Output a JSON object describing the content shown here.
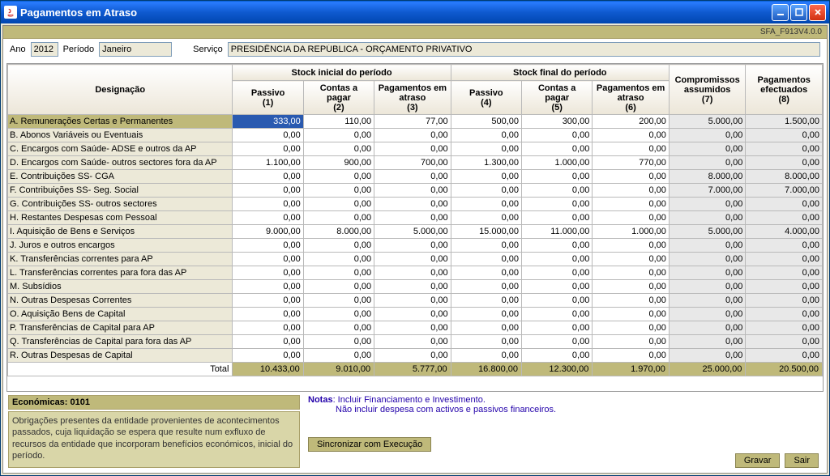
{
  "window": {
    "title": "Pagamentos em Atraso"
  },
  "version": "SFA_F913V4.0.0",
  "filters": {
    "ano_label": "Ano",
    "ano": "2012",
    "periodo_label": "Período",
    "periodo": "Janeiro",
    "servico_label": "Serviço",
    "servico": "PRESIDÊNCIA DA REPÚBLICA - ORÇAMENTO PRIVATIVO"
  },
  "headers": {
    "designacao": "Designação",
    "stock_inicial": "Stock inicial do período",
    "stock_final": "Stock final do período",
    "compromissos": "Compromissos assumidos",
    "pagamentos_efect": "Pagamentos efectuados",
    "passivo1": "Passivo\n(1)",
    "contas2": "Contas a pagar\n(2)",
    "pag3": "Pagamentos em atraso\n(3)",
    "passivo4": "Passivo\n(4)",
    "contas5": "Contas a pagar\n(5)",
    "pag6": "Pagamentos em atraso\n(6)",
    "c7": "(7)",
    "c8": "(8)"
  },
  "rows": [
    {
      "label": "A. Remunerações Certas e Permanentes",
      "v": [
        "333,00",
        "110,00",
        "77,00",
        "500,00",
        "300,00",
        "200,00",
        "5.000,00",
        "1.500,00"
      ],
      "sel": true
    },
    {
      "label": "B. Abonos Variáveis ou Eventuais",
      "v": [
        "0,00",
        "0,00",
        "0,00",
        "0,00",
        "0,00",
        "0,00",
        "0,00",
        "0,00"
      ]
    },
    {
      "label": "C. Encargos com Saúde- ADSE e outros da AP",
      "v": [
        "0,00",
        "0,00",
        "0,00",
        "0,00",
        "0,00",
        "0,00",
        "0,00",
        "0,00"
      ]
    },
    {
      "label": "D. Encargos com Saúde- outros sectores fora da AP",
      "v": [
        "1.100,00",
        "900,00",
        "700,00",
        "1.300,00",
        "1.000,00",
        "770,00",
        "0,00",
        "0,00"
      ]
    },
    {
      "label": "E. Contribuições SS- CGA",
      "v": [
        "0,00",
        "0,00",
        "0,00",
        "0,00",
        "0,00",
        "0,00",
        "8.000,00",
        "8.000,00"
      ]
    },
    {
      "label": "F. Contribuições SS- Seg. Social",
      "v": [
        "0,00",
        "0,00",
        "0,00",
        "0,00",
        "0,00",
        "0,00",
        "7.000,00",
        "7.000,00"
      ]
    },
    {
      "label": "G. Contribuições SS- outros sectores",
      "v": [
        "0,00",
        "0,00",
        "0,00",
        "0,00",
        "0,00",
        "0,00",
        "0,00",
        "0,00"
      ]
    },
    {
      "label": "H. Restantes Despesas com Pessoal",
      "v": [
        "0,00",
        "0,00",
        "0,00",
        "0,00",
        "0,00",
        "0,00",
        "0,00",
        "0,00"
      ]
    },
    {
      "label": "I. Aquisição de Bens e Serviços",
      "v": [
        "9.000,00",
        "8.000,00",
        "5.000,00",
        "15.000,00",
        "11.000,00",
        "1.000,00",
        "5.000,00",
        "4.000,00"
      ]
    },
    {
      "label": "J. Juros e outros encargos",
      "v": [
        "0,00",
        "0,00",
        "0,00",
        "0,00",
        "0,00",
        "0,00",
        "0,00",
        "0,00"
      ]
    },
    {
      "label": "K. Transferências correntes para AP",
      "v": [
        "0,00",
        "0,00",
        "0,00",
        "0,00",
        "0,00",
        "0,00",
        "0,00",
        "0,00"
      ]
    },
    {
      "label": "L. Transferências correntes para fora das AP",
      "v": [
        "0,00",
        "0,00",
        "0,00",
        "0,00",
        "0,00",
        "0,00",
        "0,00",
        "0,00"
      ]
    },
    {
      "label": "M. Subsídios",
      "v": [
        "0,00",
        "0,00",
        "0,00",
        "0,00",
        "0,00",
        "0,00",
        "0,00",
        "0,00"
      ]
    },
    {
      "label": "N. Outras Despesas Correntes",
      "v": [
        "0,00",
        "0,00",
        "0,00",
        "0,00",
        "0,00",
        "0,00",
        "0,00",
        "0,00"
      ]
    },
    {
      "label": "O. Aquisição Bens de Capital",
      "v": [
        "0,00",
        "0,00",
        "0,00",
        "0,00",
        "0,00",
        "0,00",
        "0,00",
        "0,00"
      ]
    },
    {
      "label": "P. Transferências de Capital para AP",
      "v": [
        "0,00",
        "0,00",
        "0,00",
        "0,00",
        "0,00",
        "0,00",
        "0,00",
        "0,00"
      ]
    },
    {
      "label": "Q. Transferências de Capital para fora das AP",
      "v": [
        "0,00",
        "0,00",
        "0,00",
        "0,00",
        "0,00",
        "0,00",
        "0,00",
        "0,00"
      ]
    },
    {
      "label": "R. Outras Despesas de Capital",
      "v": [
        "0,00",
        "0,00",
        "0,00",
        "0,00",
        "0,00",
        "0,00",
        "0,00",
        "0,00"
      ]
    }
  ],
  "total": {
    "label": "Total",
    "v": [
      "10.433,00",
      "9.010,00",
      "5.777,00",
      "16.800,00",
      "12.300,00",
      "1.970,00",
      "25.000,00",
      "20.500,00"
    ]
  },
  "econ": {
    "header": "Económicas: 0101",
    "text": "Obrigações presentes da entidade provenientes de acontecimentos passados, cuja liquidação se espera que resulte num exfluxo de recursos da entidade que incorporam benefícios económicos, inicial do período."
  },
  "notes": {
    "label": "Notas",
    "l1": ": Incluir Financiamento e Investimento.",
    "l2": "Não incluir despesa com activos e passivos financeiros."
  },
  "buttons": {
    "sincronizar": "Sincronizar com Execução",
    "gravar": "Gravar",
    "sair": "Sair"
  }
}
